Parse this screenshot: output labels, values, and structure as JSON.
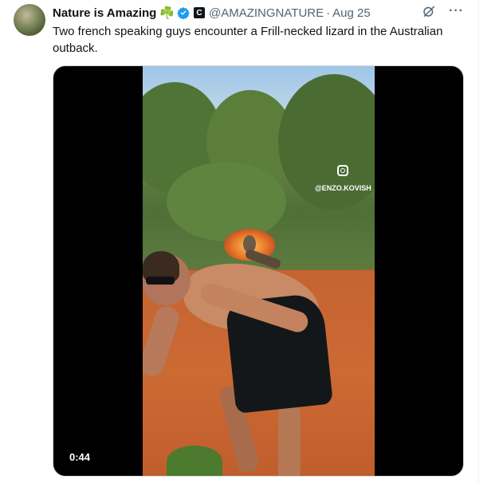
{
  "tweet": {
    "display_name": "Nature is Amazing",
    "name_emoji": "☘️",
    "affiliate_badge": "C",
    "handle": "@AMAZINGNATURE",
    "separator": "·",
    "date": "Aug 25",
    "text": "Two french speaking guys encounter a Frill-necked lizard in the Australian outback.",
    "more_label": "···"
  },
  "media": {
    "watermark": "@ENZO.KOVISH",
    "duration": "0:44"
  },
  "colors": {
    "verified": "#1d9bf0",
    "secondary_text": "#536471"
  },
  "icons": [
    "verified-badge-icon",
    "grok-icon",
    "more-icon",
    "instagram-icon"
  ]
}
